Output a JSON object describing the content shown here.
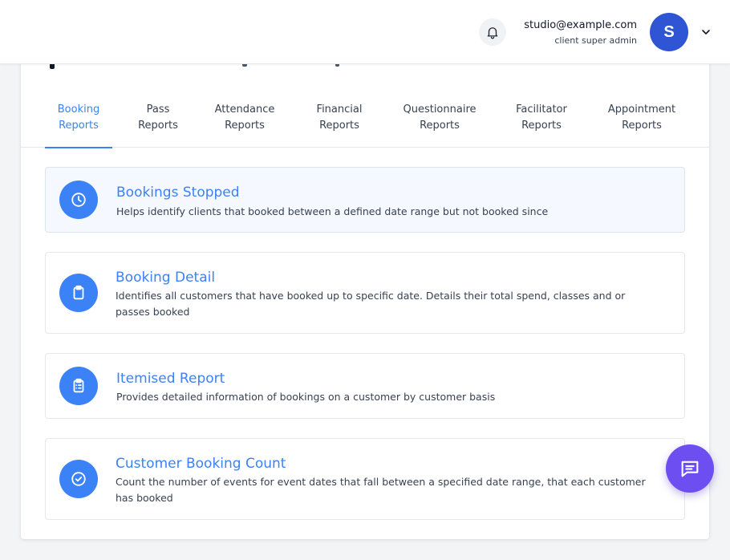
{
  "user": {
    "email": "studio@example.com",
    "role": "client super admin",
    "avatar_initial": "S"
  },
  "icons": {
    "bell": "bell-icon",
    "chevron": "chevron-down-icon",
    "chat": "chat-icon"
  },
  "colors": {
    "accent": "#3b82f6",
    "avatar": "#2f55d4",
    "chat_button": "#6d4ef0"
  },
  "tabs": [
    {
      "line1": "Booking",
      "line2": "Reports",
      "active": true
    },
    {
      "line1": "Pass",
      "line2": "Reports",
      "active": false
    },
    {
      "line1": "Attendance",
      "line2": "Reports",
      "active": false
    },
    {
      "line1": "Financial",
      "line2": "Reports",
      "active": false
    },
    {
      "line1": "Questionnaire",
      "line2": "Reports",
      "active": false
    },
    {
      "line1": "Facilitator",
      "line2": "Reports",
      "active": false
    },
    {
      "line1": "Appointment",
      "line2": "Reports",
      "active": false
    }
  ],
  "reports": [
    {
      "title": "Bookings Stopped",
      "description": "Helps identify clients that booked between a defined date range but not booked since",
      "icon": "clock-icon"
    },
    {
      "title": "Booking Detail",
      "description": "Identifies all customers that have booked up to specific date. Details their total spend, classes and or passes booked",
      "icon": "clipboard-icon"
    },
    {
      "title": "Itemised Report",
      "description": "Provides detailed information of bookings on a customer by customer basis",
      "icon": "clipboard-list-icon"
    },
    {
      "title": "Customer Booking Count",
      "description": "Count the number of events for event dates that fall between a specified date range, that each customer has booked",
      "icon": "check-circle-icon"
    }
  ]
}
